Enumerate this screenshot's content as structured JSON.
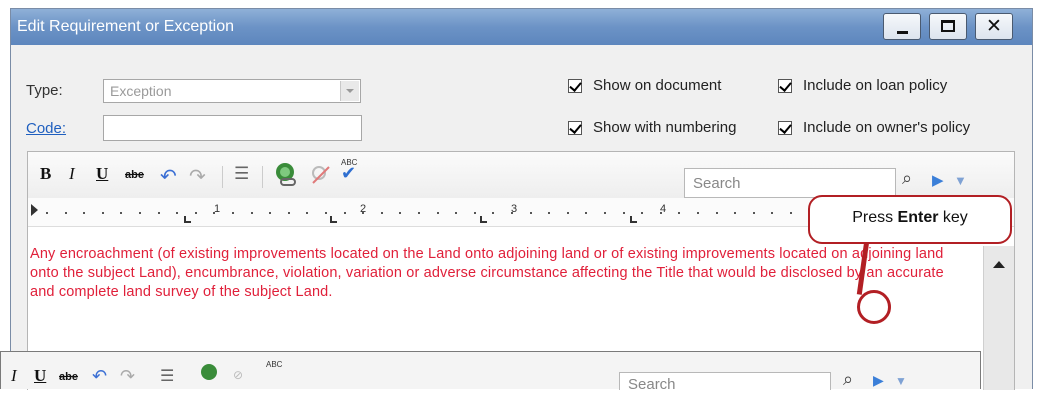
{
  "window": {
    "title": "Edit Requirement or Exception"
  },
  "form": {
    "type_label": "Type:",
    "type_value": "Exception",
    "code_label": "Code:",
    "code_value": ""
  },
  "checkboxes": [
    {
      "label": "Show on document",
      "checked": true
    },
    {
      "label": "Include on loan policy",
      "checked": true
    },
    {
      "label": "Show with numbering",
      "checked": true
    },
    {
      "label": "Include on owner's policy",
      "checked": true
    }
  ],
  "toolbar": {
    "bold": "B",
    "italic": "I",
    "underline": "U",
    "strike": "abe",
    "spell_label": "ABC",
    "search_placeholder": "Search",
    "icons": [
      "undo-icon",
      "redo-icon",
      "columns-icon",
      "link-icon",
      "unlink-icon",
      "spellcheck-icon",
      "find-icon",
      "play-icon",
      "dropdown-icon"
    ]
  },
  "ruler": {
    "numbers": [
      "1",
      "2",
      "3",
      "4"
    ]
  },
  "editor": {
    "text": "Any encroachment (of existing improvements located on the Land onto adjoining land or of existing improvements located on adjoining land onto the subject Land), encumbrance, violation, variation or adverse circumstance affecting the Title that would be disclosed by an accurate and complete land survey of the subject Land."
  },
  "callout": {
    "prefix": "Press ",
    "bold": "Enter",
    "suffix": " key"
  },
  "colors": {
    "title_bar": "#6c93c6",
    "body_text": "#e0203a",
    "callout_border": "#b21f24"
  }
}
